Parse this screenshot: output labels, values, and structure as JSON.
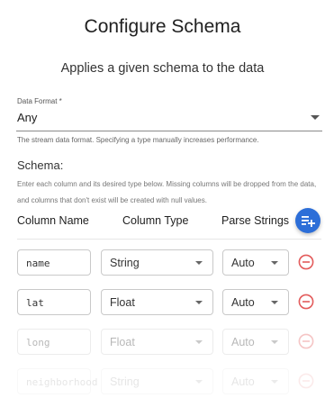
{
  "header": {
    "title": "Configure Schema",
    "subtitle": "Applies a given schema to the data"
  },
  "data_format": {
    "label": "Data Format *",
    "value": "Any",
    "helper": "The stream data format. Specifying a type manually increases performance."
  },
  "schema": {
    "label": "Schema:",
    "help": "Enter each column and its desired type below. Missing columns will be dropped from the data, and columns that don't exist will be created with null values."
  },
  "columns": {
    "name_header": "Column Name",
    "type_header": "Column Type",
    "parse_header": "Parse Strings"
  },
  "add_icon": "playlist-add-icon",
  "remove_icon": "remove-circle-icon",
  "colors": {
    "accent": "#2c6ed8",
    "remove": "#e35b5b"
  },
  "rows": [
    {
      "name": "name",
      "type": "String",
      "parse": "Auto"
    },
    {
      "name": "lat",
      "type": "Float",
      "parse": "Auto"
    },
    {
      "name": "long",
      "type": "Float",
      "parse": "Auto"
    },
    {
      "name": "neighborhood",
      "type": "String",
      "parse": "Auto"
    }
  ]
}
